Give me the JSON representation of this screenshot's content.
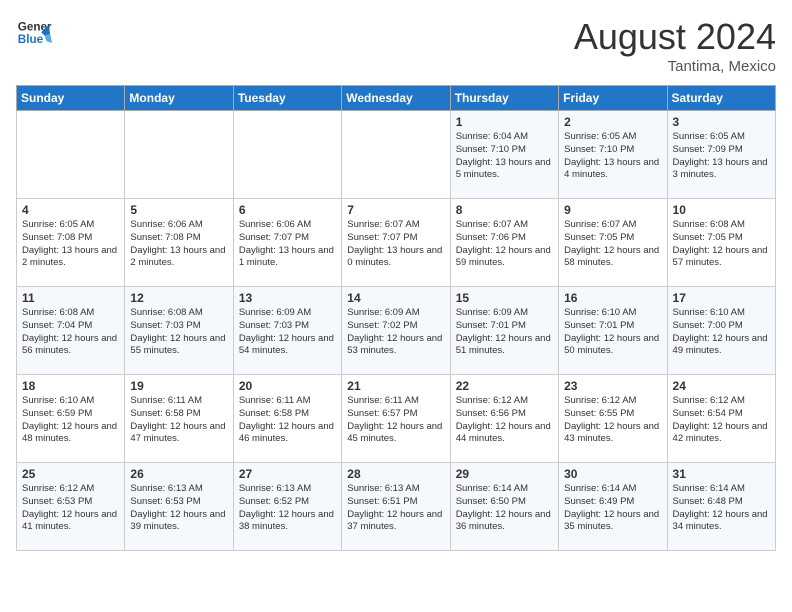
{
  "header": {
    "logo_line1": "General",
    "logo_line2": "Blue",
    "month_year": "August 2024",
    "location": "Tantima, Mexico"
  },
  "days_of_week": [
    "Sunday",
    "Monday",
    "Tuesday",
    "Wednesday",
    "Thursday",
    "Friday",
    "Saturday"
  ],
  "weeks": [
    [
      {
        "day": "",
        "sunrise": "",
        "sunset": "",
        "daylight": ""
      },
      {
        "day": "",
        "sunrise": "",
        "sunset": "",
        "daylight": ""
      },
      {
        "day": "",
        "sunrise": "",
        "sunset": "",
        "daylight": ""
      },
      {
        "day": "",
        "sunrise": "",
        "sunset": "",
        "daylight": ""
      },
      {
        "day": "1",
        "sunrise": "Sunrise: 6:04 AM",
        "sunset": "Sunset: 7:10 PM",
        "daylight": "Daylight: 13 hours and 5 minutes."
      },
      {
        "day": "2",
        "sunrise": "Sunrise: 6:05 AM",
        "sunset": "Sunset: 7:10 PM",
        "daylight": "Daylight: 13 hours and 4 minutes."
      },
      {
        "day": "3",
        "sunrise": "Sunrise: 6:05 AM",
        "sunset": "Sunset: 7:09 PM",
        "daylight": "Daylight: 13 hours and 3 minutes."
      }
    ],
    [
      {
        "day": "4",
        "sunrise": "Sunrise: 6:05 AM",
        "sunset": "Sunset: 7:08 PM",
        "daylight": "Daylight: 13 hours and 2 minutes."
      },
      {
        "day": "5",
        "sunrise": "Sunrise: 6:06 AM",
        "sunset": "Sunset: 7:08 PM",
        "daylight": "Daylight: 13 hours and 2 minutes."
      },
      {
        "day": "6",
        "sunrise": "Sunrise: 6:06 AM",
        "sunset": "Sunset: 7:07 PM",
        "daylight": "Daylight: 13 hours and 1 minute."
      },
      {
        "day": "7",
        "sunrise": "Sunrise: 6:07 AM",
        "sunset": "Sunset: 7:07 PM",
        "daylight": "Daylight: 13 hours and 0 minutes."
      },
      {
        "day": "8",
        "sunrise": "Sunrise: 6:07 AM",
        "sunset": "Sunset: 7:06 PM",
        "daylight": "Daylight: 12 hours and 59 minutes."
      },
      {
        "day": "9",
        "sunrise": "Sunrise: 6:07 AM",
        "sunset": "Sunset: 7:05 PM",
        "daylight": "Daylight: 12 hours and 58 minutes."
      },
      {
        "day": "10",
        "sunrise": "Sunrise: 6:08 AM",
        "sunset": "Sunset: 7:05 PM",
        "daylight": "Daylight: 12 hours and 57 minutes."
      }
    ],
    [
      {
        "day": "11",
        "sunrise": "Sunrise: 6:08 AM",
        "sunset": "Sunset: 7:04 PM",
        "daylight": "Daylight: 12 hours and 56 minutes."
      },
      {
        "day": "12",
        "sunrise": "Sunrise: 6:08 AM",
        "sunset": "Sunset: 7:03 PM",
        "daylight": "Daylight: 12 hours and 55 minutes."
      },
      {
        "day": "13",
        "sunrise": "Sunrise: 6:09 AM",
        "sunset": "Sunset: 7:03 PM",
        "daylight": "Daylight: 12 hours and 54 minutes."
      },
      {
        "day": "14",
        "sunrise": "Sunrise: 6:09 AM",
        "sunset": "Sunset: 7:02 PM",
        "daylight": "Daylight: 12 hours and 53 minutes."
      },
      {
        "day": "15",
        "sunrise": "Sunrise: 6:09 AM",
        "sunset": "Sunset: 7:01 PM",
        "daylight": "Daylight: 12 hours and 51 minutes."
      },
      {
        "day": "16",
        "sunrise": "Sunrise: 6:10 AM",
        "sunset": "Sunset: 7:01 PM",
        "daylight": "Daylight: 12 hours and 50 minutes."
      },
      {
        "day": "17",
        "sunrise": "Sunrise: 6:10 AM",
        "sunset": "Sunset: 7:00 PM",
        "daylight": "Daylight: 12 hours and 49 minutes."
      }
    ],
    [
      {
        "day": "18",
        "sunrise": "Sunrise: 6:10 AM",
        "sunset": "Sunset: 6:59 PM",
        "daylight": "Daylight: 12 hours and 48 minutes."
      },
      {
        "day": "19",
        "sunrise": "Sunrise: 6:11 AM",
        "sunset": "Sunset: 6:58 PM",
        "daylight": "Daylight: 12 hours and 47 minutes."
      },
      {
        "day": "20",
        "sunrise": "Sunrise: 6:11 AM",
        "sunset": "Sunset: 6:58 PM",
        "daylight": "Daylight: 12 hours and 46 minutes."
      },
      {
        "day": "21",
        "sunrise": "Sunrise: 6:11 AM",
        "sunset": "Sunset: 6:57 PM",
        "daylight": "Daylight: 12 hours and 45 minutes."
      },
      {
        "day": "22",
        "sunrise": "Sunrise: 6:12 AM",
        "sunset": "Sunset: 6:56 PM",
        "daylight": "Daylight: 12 hours and 44 minutes."
      },
      {
        "day": "23",
        "sunrise": "Sunrise: 6:12 AM",
        "sunset": "Sunset: 6:55 PM",
        "daylight": "Daylight: 12 hours and 43 minutes."
      },
      {
        "day": "24",
        "sunrise": "Sunrise: 6:12 AM",
        "sunset": "Sunset: 6:54 PM",
        "daylight": "Daylight: 12 hours and 42 minutes."
      }
    ],
    [
      {
        "day": "25",
        "sunrise": "Sunrise: 6:12 AM",
        "sunset": "Sunset: 6:53 PM",
        "daylight": "Daylight: 12 hours and 41 minutes."
      },
      {
        "day": "26",
        "sunrise": "Sunrise: 6:13 AM",
        "sunset": "Sunset: 6:53 PM",
        "daylight": "Daylight: 12 hours and 39 minutes."
      },
      {
        "day": "27",
        "sunrise": "Sunrise: 6:13 AM",
        "sunset": "Sunset: 6:52 PM",
        "daylight": "Daylight: 12 hours and 38 minutes."
      },
      {
        "day": "28",
        "sunrise": "Sunrise: 6:13 AM",
        "sunset": "Sunset: 6:51 PM",
        "daylight": "Daylight: 12 hours and 37 minutes."
      },
      {
        "day": "29",
        "sunrise": "Sunrise: 6:14 AM",
        "sunset": "Sunset: 6:50 PM",
        "daylight": "Daylight: 12 hours and 36 minutes."
      },
      {
        "day": "30",
        "sunrise": "Sunrise: 6:14 AM",
        "sunset": "Sunset: 6:49 PM",
        "daylight": "Daylight: 12 hours and 35 minutes."
      },
      {
        "day": "31",
        "sunrise": "Sunrise: 6:14 AM",
        "sunset": "Sunset: 6:48 PM",
        "daylight": "Daylight: 12 hours and 34 minutes."
      }
    ]
  ]
}
